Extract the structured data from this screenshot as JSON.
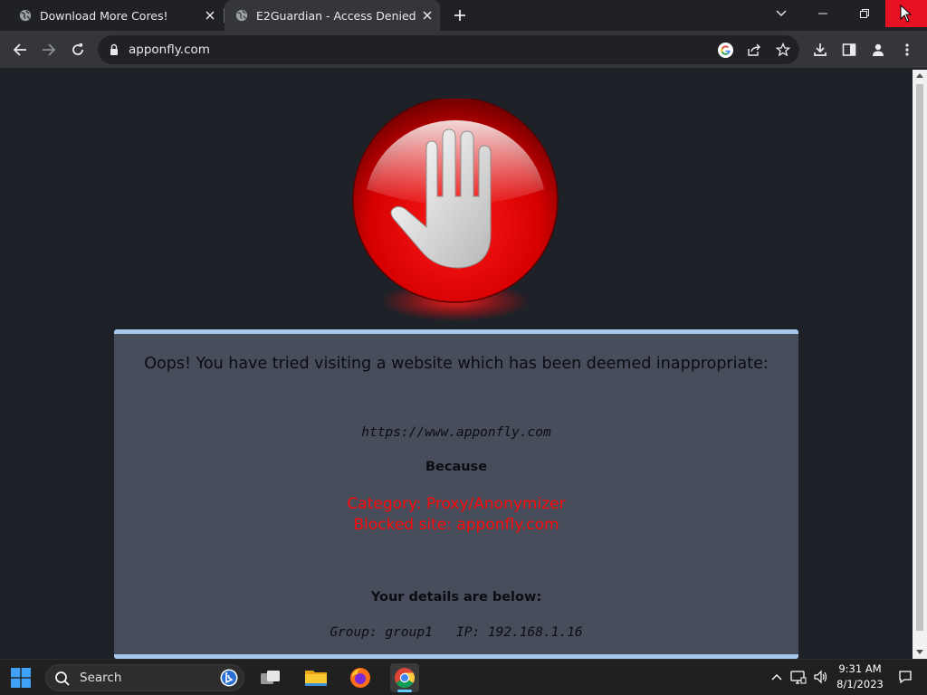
{
  "browser": {
    "tabs": [
      {
        "title": "Download More Cores!",
        "icon": "globe-icon",
        "active": false
      },
      {
        "title": "E2Guardian - Access Denied",
        "icon": "globe-icon",
        "active": true
      }
    ],
    "address": "apponfly.com",
    "toolbar_icons": [
      "back-icon",
      "forward-icon",
      "reload-icon",
      "lock-icon",
      "google-icon",
      "share-icon",
      "star-icon",
      "download-icon",
      "side-panel-icon",
      "profile-icon",
      "menu-icon"
    ]
  },
  "page": {
    "headline": "Oops! You have tried visiting a website which has been deemed inappropriate:",
    "blocked_url": "https://www.apponfly.com",
    "because": "Because",
    "reason_category": "Category: Proxy/Anonymizer",
    "reason_site": "Blocked site: apponfly.com",
    "details_title": "Your details are below:",
    "details": "Group: group1   IP: 192.168.1.16",
    "colors": {
      "panel_bg": "#474d5b",
      "panel_border": "#a6c8ea",
      "reason_text": "#ff0a0a",
      "page_bg": "#1f2128"
    }
  },
  "taskbar": {
    "search_label": "Search",
    "time": "9:31 AM",
    "date": "8/1/2023",
    "apps": [
      "task-view-icon",
      "file-explorer-icon",
      "firefox-icon",
      "chrome-icon"
    ],
    "tray": [
      "chevron-up-icon",
      "network-icon",
      "volume-icon",
      "notification-icon"
    ]
  }
}
